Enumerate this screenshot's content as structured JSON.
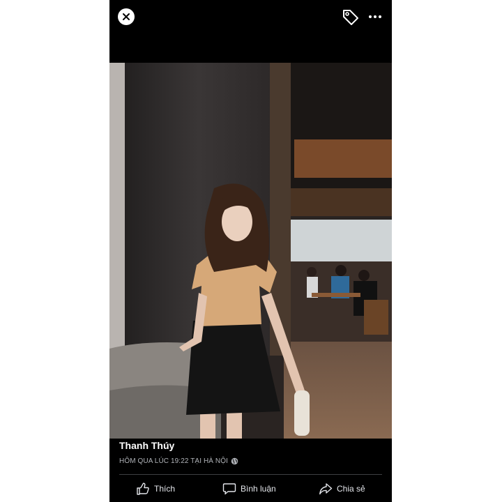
{
  "post": {
    "author": "Thanh Thúy",
    "timestamp": "HÔM QUA LÚC 19:22 TẠI HÀ NỘI"
  },
  "toolbar": {
    "close_icon": "close-icon",
    "tag_icon": "tag-icon",
    "more_icon": "more-options-icon"
  },
  "actions": {
    "like_label": "Thích",
    "comment_label": "Bình luận",
    "share_label": "Chia sẻ"
  },
  "colors": {
    "background": "#000000",
    "text_primary": "#ffffff",
    "text_secondary": "#b0b3b8",
    "divider": "#3e4042"
  }
}
